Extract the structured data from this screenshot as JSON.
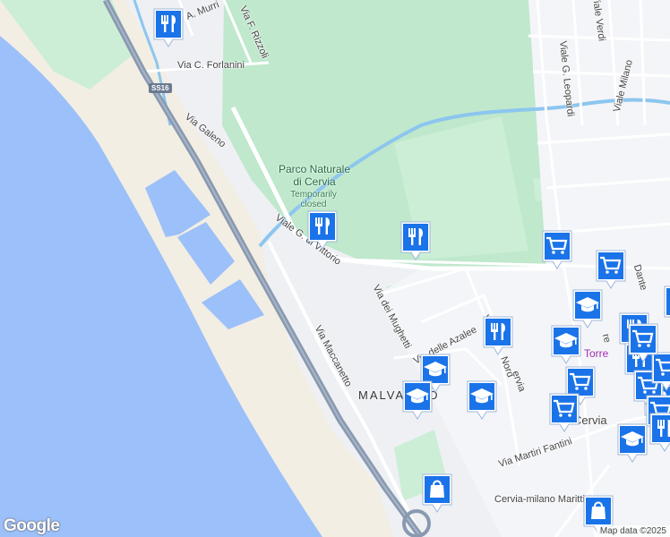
{
  "map": {
    "colors": {
      "sea": "#9cc0f9",
      "beach": "#f2eee3",
      "park": "#bfe8cc",
      "land": "#eef0f4",
      "canal": "#8cc6ef",
      "highway": "#8899b0",
      "marker": "#1a73e8"
    },
    "logo": "Google",
    "attribution": "Map data ©2025",
    "route_shield": "SS16",
    "park": {
      "name_line1": "Parco Naturale",
      "name_line2": "di Cervia",
      "status_line1": "Temporarily",
      "status_line2": "closed"
    },
    "district": "MALVA SUD",
    "poi_label": "Torre",
    "streets": {
      "a_murri": "A. Murri",
      "f_rizzoli": "Via F. Rizzoli",
      "c_forlanini": "Via C. Forlanini",
      "galeno": "Via Galeno",
      "g_di_vittorio": "Viale G. di Vittorio",
      "maccanetto": "Via Maccanetto",
      "mughetti": "Via dei Mughetti",
      "azalee": "Via delle Azalee",
      "nord": "Nord",
      "g_leopardi": "Viale G. Leopardi",
      "verdi": "Viale Verdi",
      "milano": "Viale Milano",
      "martiri_fantini": "Via Martiri Fantini",
      "dante": "Dante",
      "re": "re",
      "cervia": "Cervia",
      "cervia_milano": "Cervia-milano Marittima",
      "via_edge": "Via",
      "ervia": "ervia"
    },
    "markers": [
      {
        "type": "restaurant-icon"
      },
      {
        "type": "restaurant-icon"
      },
      {
        "type": "restaurant-icon"
      },
      {
        "type": "restaurant-icon"
      },
      {
        "type": "restaurant-icon"
      },
      {
        "type": "restaurant-icon"
      },
      {
        "type": "shopping-cart-icon"
      },
      {
        "type": "shopping-cart-icon"
      },
      {
        "type": "shopping-cart-icon"
      },
      {
        "type": "shopping-cart-icon"
      },
      {
        "type": "shopping-cart-icon"
      },
      {
        "type": "shopping-cart-icon"
      },
      {
        "type": "school-icon"
      },
      {
        "type": "school-icon"
      },
      {
        "type": "school-icon"
      },
      {
        "type": "school-icon"
      },
      {
        "type": "school-icon"
      },
      {
        "type": "school-icon"
      },
      {
        "type": "shopping-bag-icon"
      },
      {
        "type": "shopping-bag-icon"
      },
      {
        "type": "restaurant-icon"
      },
      {
        "type": "shopping-cart-icon"
      },
      {
        "type": "restaurant-icon"
      },
      {
        "type": "shopping-cart-icon"
      },
      {
        "type": "restaurant-icon"
      }
    ]
  }
}
